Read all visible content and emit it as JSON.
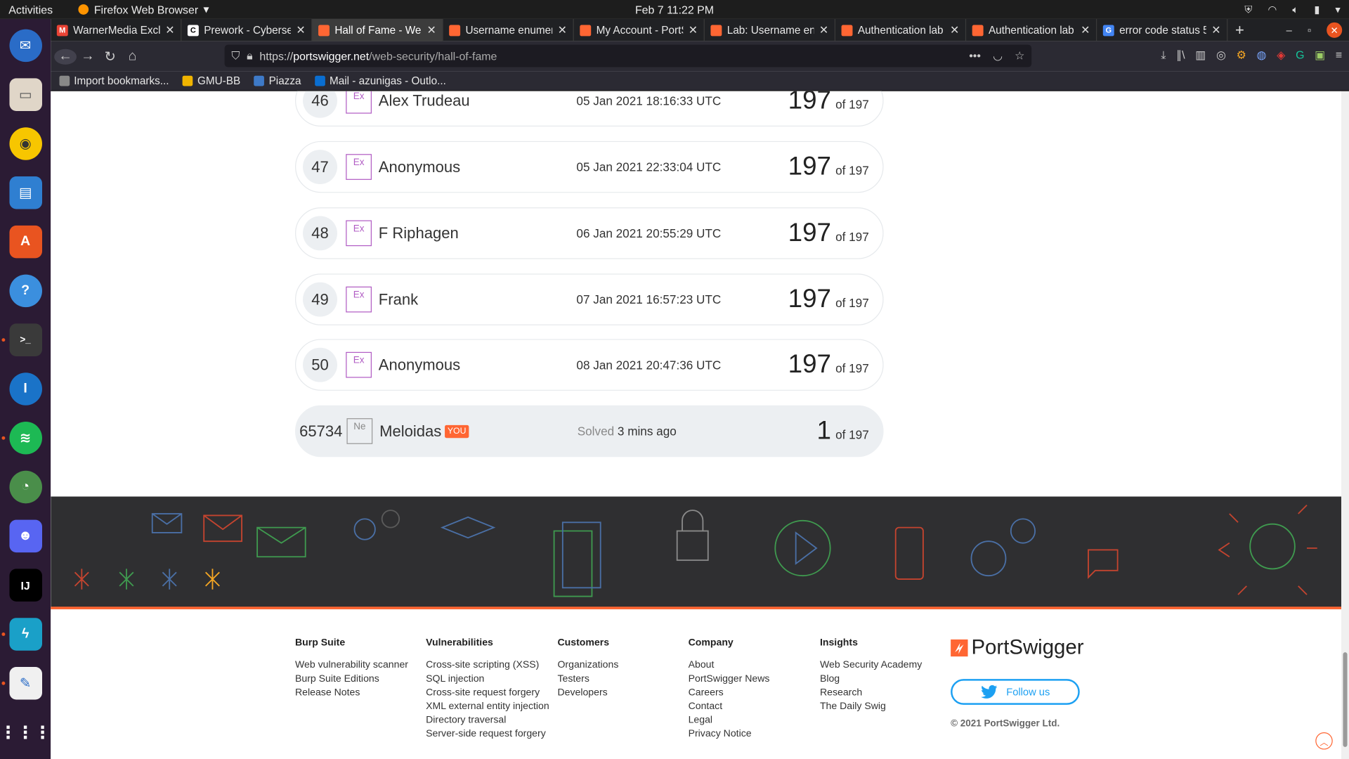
{
  "system": {
    "activities": "Activities",
    "app_name": "Firefox Web Browser",
    "clock": "Feb 7  11:22 PM"
  },
  "tabs": [
    {
      "title": "WarnerMedia Exclu",
      "color": "#ea4335",
      "glyph": "M"
    },
    {
      "title": "Prework - Cyberse",
      "color": "#ffffff",
      "glyph": "C"
    },
    {
      "title": "Hall of Fame - Web",
      "color": "#ff6633",
      "glyph": "",
      "active": true
    },
    {
      "title": "Username enumer",
      "color": "#ff6633",
      "glyph": ""
    },
    {
      "title": "My Account - PortS",
      "color": "#ff6633",
      "glyph": ""
    },
    {
      "title": "Lab: Username enu",
      "color": "#ff6633",
      "glyph": ""
    },
    {
      "title": "Authentication lab",
      "color": "#ff6633",
      "glyph": ""
    },
    {
      "title": "Authentication lab",
      "color": "#ff6633",
      "glyph": ""
    },
    {
      "title": "error code status 5",
      "color": "#4285f4",
      "glyph": "G"
    }
  ],
  "url": {
    "scheme": "https://",
    "host": "portswigger.net",
    "path": "/web-security/hall-of-fame"
  },
  "bookmarks": [
    {
      "label": "Import bookmarks...",
      "color": "#888888"
    },
    {
      "label": "GMU-BB",
      "color": "#f0b400"
    },
    {
      "label": "Piazza",
      "color": "#3e7ac8"
    },
    {
      "label": "Mail - azunigas - Outlo...",
      "color": "#0a6ed1"
    }
  ],
  "leaderboard": [
    {
      "rank": "46",
      "badge": "Ex",
      "name": "Alex Trudeau",
      "date": "05 Jan 2021 18:16:33 UTC",
      "score": "197",
      "total": "of 197"
    },
    {
      "rank": "47",
      "badge": "Ex",
      "name": "Anonymous",
      "date": "05 Jan 2021 22:33:04 UTC",
      "score": "197",
      "total": "of 197"
    },
    {
      "rank": "48",
      "badge": "Ex",
      "name": "F Riphagen",
      "date": "06 Jan 2021 20:55:29 UTC",
      "score": "197",
      "total": "of 197"
    },
    {
      "rank": "49",
      "badge": "Ex",
      "name": "Frank",
      "date": "07 Jan 2021 16:57:23 UTC",
      "score": "197",
      "total": "of 197"
    },
    {
      "rank": "50",
      "badge": "Ex",
      "name": "Anonymous",
      "date": "08 Jan 2021 20:47:36 UTC",
      "score": "197",
      "total": "of 197"
    }
  ],
  "you_row": {
    "rank": "65734",
    "badge": "Ne",
    "name": "Meloidas",
    "tag": "YOU",
    "solved_label": "Solved",
    "solved_when": "3 mins ago",
    "score": "1",
    "total": "of 197"
  },
  "footer": {
    "columns": [
      {
        "heading": "Burp Suite",
        "links": [
          "Web vulnerability scanner",
          "Burp Suite Editions",
          "Release Notes"
        ]
      },
      {
        "heading": "Vulnerabilities",
        "links": [
          "Cross-site scripting (XSS)",
          "SQL injection",
          "Cross-site request forgery",
          "XML external entity injection",
          "Directory traversal",
          "Server-side request forgery"
        ]
      },
      {
        "heading": "Customers",
        "links": [
          "Organizations",
          "Testers",
          "Developers"
        ]
      },
      {
        "heading": "Company",
        "links": [
          "About",
          "PortSwigger News",
          "Careers",
          "Contact",
          "Legal",
          "Privacy Notice"
        ]
      },
      {
        "heading": "Insights",
        "links": [
          "Web Security Academy",
          "Blog",
          "Research",
          "The Daily Swig"
        ]
      }
    ],
    "brand": "PortSwigger",
    "follow_label": "Follow us",
    "copyright": "© 2021 PortSwigger Ltd."
  },
  "colors": {
    "accent": "#ff6633",
    "badge_expert": "#b15cc4",
    "twitter": "#1ca0f2"
  }
}
